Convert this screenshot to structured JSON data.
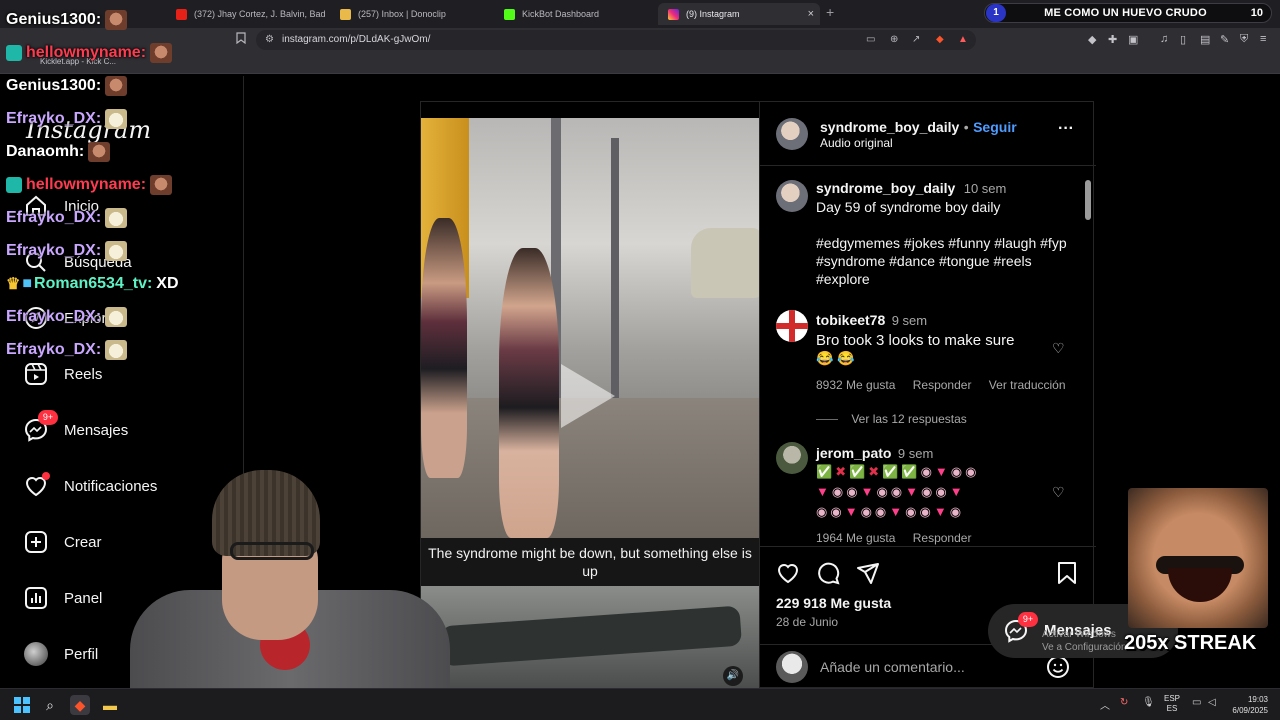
{
  "browser": {
    "tabs": [
      {
        "label": "(372) Jhay Cortez, J. Balvin, Bad Bunn",
        "active": false
      },
      {
        "label": "(257) Inbox | Donoclip",
        "active": false
      },
      {
        "label": "KickBot Dashboard",
        "active": false
      },
      {
        "label": "(9) Instagram",
        "active": true
      }
    ],
    "tab_close": "×",
    "new_tab": "+",
    "url": "instagram.com/p/DLdAK-gJwOm/",
    "bookmark": "Kicklet.app - Kick C..."
  },
  "song_bar": {
    "index": "1",
    "title": "ME COMO UN HUEVO CRUDO",
    "count": "10"
  },
  "chat": [
    {
      "user": "Genius1300:",
      "color": "#ffffff",
      "text": "",
      "emote": "face"
    },
    {
      "user": "hellowmyname:",
      "color": "#ff3b4f",
      "text": "",
      "emote": "face",
      "badge": true
    },
    {
      "user": "Genius1300:",
      "color": "#ffffff",
      "text": "",
      "emote": "face"
    },
    {
      "user": "Efrayko_DX:",
      "color": "#c9a7ff",
      "text": "",
      "emote": "cat"
    },
    {
      "user": "Danaomh:",
      "color": "#ffffff",
      "text": "",
      "emote": "face"
    },
    {
      "user": "hellowmyname:",
      "color": "#ff3b4f",
      "text": "",
      "emote": "face",
      "badge": true
    },
    {
      "user": "Efrayko_DX:",
      "color": "#c9a7ff",
      "text": "",
      "emote": "cat"
    },
    {
      "user": "Efrayko_DX:",
      "color": "#c9a7ff",
      "text": "",
      "emote": "cat"
    },
    {
      "user": "Roman6534_tv:",
      "color": "#5ef2c4",
      "text": "XD",
      "emote": "",
      "crown": true
    },
    {
      "user": "Efrayko_DX:",
      "color": "#c9a7ff",
      "text": "",
      "emote": "cat"
    },
    {
      "user": "Efrayko_DX:",
      "color": "#c9a7ff",
      "text": "",
      "emote": "cat"
    }
  ],
  "sidebar": {
    "logo": "Instagram",
    "items": [
      {
        "label": "Inicio",
        "icon": "home-icon"
      },
      {
        "label": "Búsqueda",
        "icon": "search-icon"
      },
      {
        "label": "Explorar",
        "icon": "compass-icon"
      },
      {
        "label": "Reels",
        "icon": "reels-icon"
      },
      {
        "label": "Mensajes",
        "icon": "messenger-icon",
        "badge": "9+"
      },
      {
        "label": "Notificaciones",
        "icon": "heart-icon",
        "dot": true
      },
      {
        "label": "Crear",
        "icon": "plus-square-icon"
      },
      {
        "label": "Panel",
        "icon": "chart-icon"
      },
      {
        "label": "Perfil",
        "icon": "avatar-icon"
      }
    ]
  },
  "post": {
    "author": "syndrome_boy_daily",
    "follow": "Seguir",
    "separator": "•",
    "audio": "Audio original",
    "more": "···",
    "caption_text": "The syndrome might be down, but something else is up",
    "description": {
      "author": "syndrome_boy_daily",
      "time": "10 sem",
      "text": "Day 59 of syndrome boy daily",
      "hashtags": "#edgymemes #jokes #funny #laugh #fyp #syndrome #dance #tongue #reels #explore"
    },
    "comments": [
      {
        "user": "tobikeet78",
        "time": "9 sem",
        "text": "Bro took 3 looks to make sure",
        "emojis": "😂 😂",
        "likes": "8932 Me gusta",
        "reply": "Responder",
        "translate": "Ver traducción",
        "view_replies": "Ver las 12 respuestas"
      },
      {
        "user": "jerom_pato",
        "time": "9 sem",
        "likes": "1964 Me gusta",
        "reply": "Responder"
      }
    ],
    "likes": "229 918 Me gusta",
    "date": "28 de Junio",
    "add_comment_placeholder": "Añade un comentario...",
    "mute": "🔊"
  },
  "toast": {
    "label": "Mensajes",
    "badge": "9+"
  },
  "watermark": {
    "line1": "Activar Windows",
    "line2": "Ve a Configuración"
  },
  "streak": "205x STREAK",
  "taskbar": {
    "lang1": "ESP",
    "lang2": "ES",
    "time": "19:03",
    "date": "6/09/2025"
  },
  "colors": {
    "accent_blue": "#4f9cff",
    "badge_red": "#ff3040",
    "hashtag": "#7ea6ff"
  }
}
